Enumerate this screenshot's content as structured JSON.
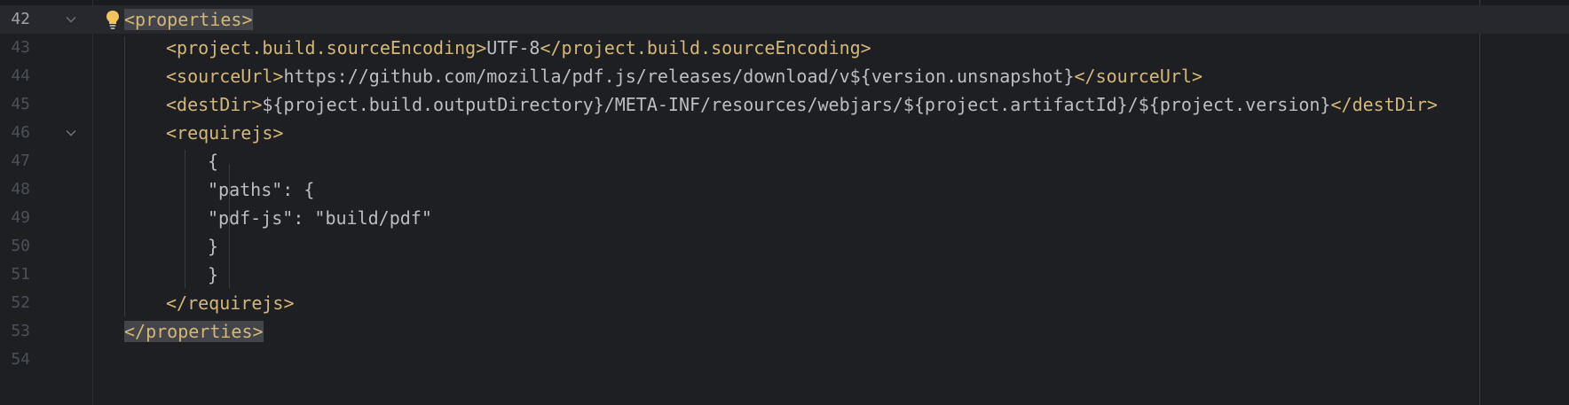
{
  "editor": {
    "lines": [
      {
        "number": "42",
        "current": true,
        "fold": true,
        "bulb": true,
        "indent": 0,
        "segments": [
          {
            "kind": "tag",
            "text": "<properties>",
            "hl": true
          }
        ]
      },
      {
        "number": "43",
        "indent": 1,
        "segments": [
          {
            "kind": "tag",
            "text": "<project.build.sourceEncoding>"
          },
          {
            "kind": "text",
            "text": "UTF-8"
          },
          {
            "kind": "tag",
            "text": "</project.build.sourceEncoding>"
          }
        ]
      },
      {
        "number": "44",
        "indent": 1,
        "segments": [
          {
            "kind": "tag",
            "text": "<sourceUrl>"
          },
          {
            "kind": "text",
            "text": "https://github.com/mozilla/pdf.js/releases/download/v${version.unsnapshot}"
          },
          {
            "kind": "tag",
            "text": "</sourceUrl>"
          }
        ]
      },
      {
        "number": "45",
        "indent": 1,
        "segments": [
          {
            "kind": "tag",
            "text": "<destDir>"
          },
          {
            "kind": "text",
            "text": "${project.build.outputDirectory}/META-INF/resources/webjars/${project.artifactId}/${project.version}"
          },
          {
            "kind": "tag",
            "text": "</destDir>"
          }
        ]
      },
      {
        "number": "46",
        "fold": true,
        "indent": 1,
        "segments": [
          {
            "kind": "tag",
            "text": "<requirejs>"
          }
        ]
      },
      {
        "number": "47",
        "indent": 2,
        "segments": [
          {
            "kind": "text",
            "text": "{"
          }
        ]
      },
      {
        "number": "48",
        "indent": 2,
        "segments": [
          {
            "kind": "text",
            "text": "\"paths\": {"
          }
        ]
      },
      {
        "number": "49",
        "indent": 2,
        "segments": [
          {
            "kind": "text",
            "text": "\"pdf-js\": \"build/pdf\""
          }
        ]
      },
      {
        "number": "50",
        "indent": 2,
        "segments": [
          {
            "kind": "text",
            "text": "}"
          }
        ]
      },
      {
        "number": "51",
        "indent": 2,
        "segments": [
          {
            "kind": "text",
            "text": "}"
          }
        ]
      },
      {
        "number": "52",
        "indent": 1,
        "segments": [
          {
            "kind": "tag",
            "text": "</requirejs>"
          }
        ]
      },
      {
        "number": "53",
        "indent": 0,
        "segments": [
          {
            "kind": "tag",
            "text": "</properties>",
            "hl": true
          }
        ]
      },
      {
        "number": "54",
        "indent": 0,
        "segments": []
      }
    ]
  },
  "colors": {
    "background": "#1e1f22",
    "current_line": "#26282e",
    "tag": "#d5b778",
    "text": "#bcbec4",
    "line_number": "#4b5059",
    "bulb": "#f2c55c"
  },
  "icons": {
    "fold": "chevron-down-icon",
    "bulb": "lightbulb-icon"
  }
}
